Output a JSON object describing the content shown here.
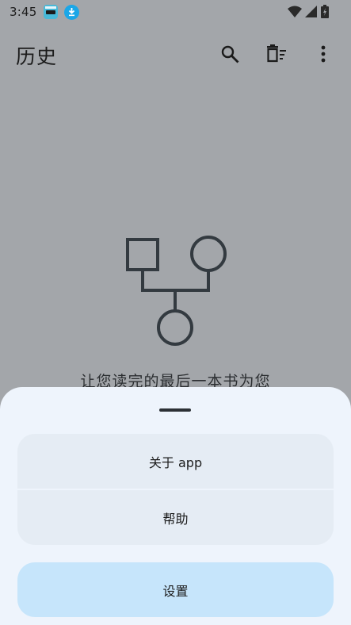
{
  "status_bar": {
    "time": "3:45",
    "icons": [
      "app-notification-icon",
      "download-icon",
      "wifi-icon",
      "signal-icon",
      "battery-icon"
    ]
  },
  "app_bar": {
    "title": "历史",
    "actions": [
      "search-icon",
      "delete-history-icon",
      "more-vert-icon"
    ]
  },
  "empty_state": {
    "icon": "family-tree-icon",
    "text": "让您读完的最后一本书为您"
  },
  "bottom_sheet": {
    "items": [
      {
        "label": "关于 app"
      },
      {
        "label": "帮助"
      },
      {
        "label": "设置"
      }
    ]
  },
  "colors": {
    "scrim_background": "#a3a6aa",
    "sheet_background": "#eef4fc",
    "menu_item_background": "#e5ecf4",
    "settings_background": "#c6e5fb",
    "icon_color": "#1b1b1b"
  }
}
